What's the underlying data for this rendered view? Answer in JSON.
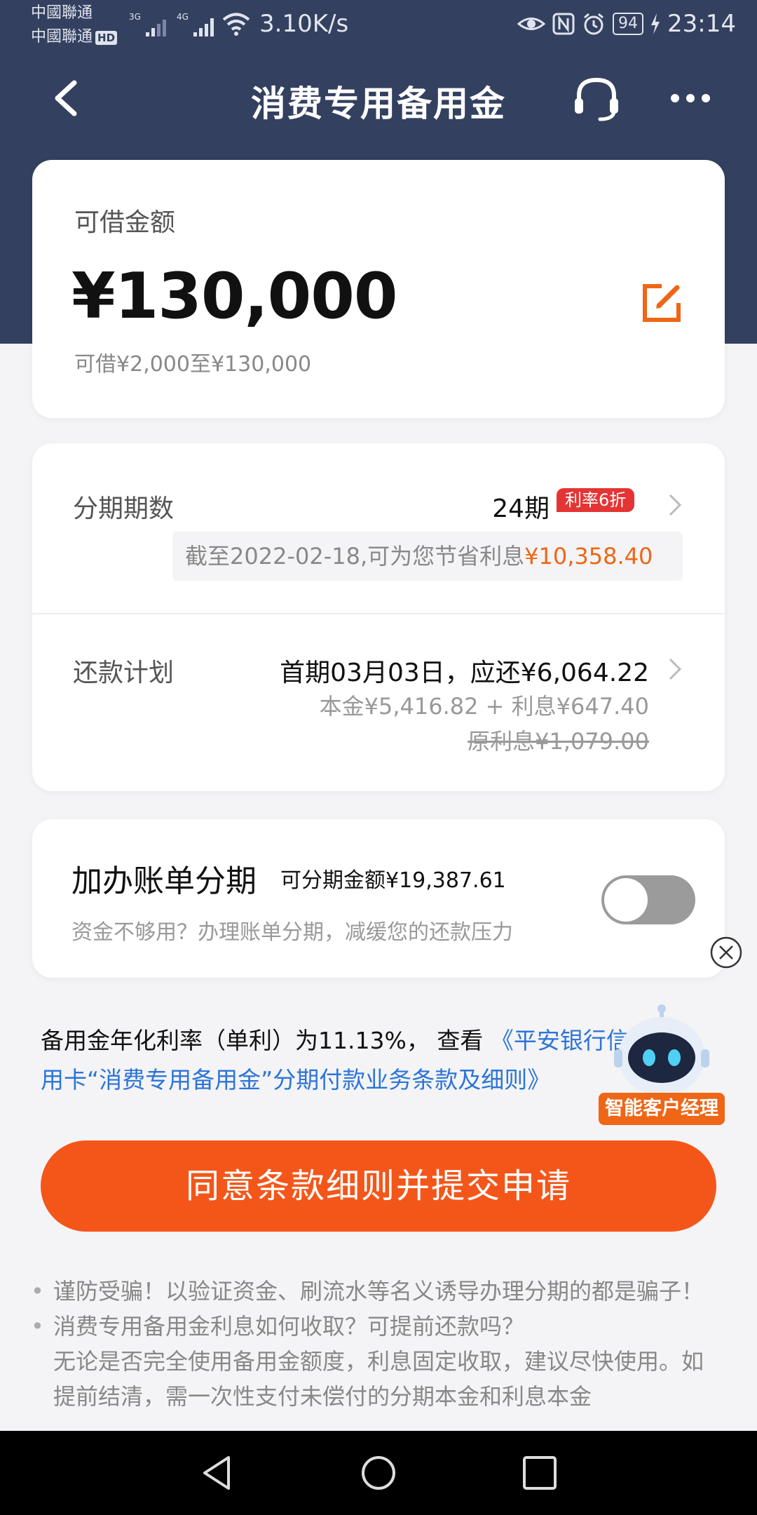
{
  "status_bar": {
    "carrier_1": "中國聯通",
    "carrier_2": "中國聯通",
    "hd": "HD",
    "net_3g": "3G",
    "net_4g": "4G",
    "speed": "3.10K/s",
    "battery": "94",
    "time": "23:14"
  },
  "nav": {
    "title": "消费专用备用金",
    "back_icon": "chevron-left-icon",
    "service_icon": "headset-icon",
    "more_icon": "more-dots-icon"
  },
  "amount_card": {
    "label": "可借金额",
    "value": "¥130,000",
    "range": "可借¥2,000至¥130,000",
    "edit_icon": "edit-icon"
  },
  "plan_card": {
    "period_label": "分期期数",
    "period_value": "24期",
    "rate_badge": "利率6折",
    "savings_text": "截至2022-02-18,可为您节省利息",
    "savings_amount": "¥10,358.40",
    "repay_label": "还款计划",
    "repay_first": "首期03月03日，应还¥6,064.22",
    "repay_breakdown": "本金¥5,416.82 + 利息¥647.40",
    "repay_original": "原利息¥1,079.00"
  },
  "bill_card": {
    "title": "加办账单分期",
    "available": "可分期金额¥19,387.61",
    "desc": "资金不够用？办理账单分期，减缓您的还款压力",
    "toggle_on": false
  },
  "terms": {
    "text": "备用金年化利率（单利）为11.13%， 查看 ",
    "link": "《平安银行信用卡“消费专用备用金”分期付款业务条款及细则》"
  },
  "assistant": {
    "label": "智能客户经理"
  },
  "submit_label": "同意条款细则并提交申请",
  "tips": [
    {
      "title": "谨防受骗！以验证资金、刷流水等名义诱导办理分期的都是骗子！"
    },
    {
      "title": "消费专用备用金利息如何收取？可提前还款吗？",
      "body": "无论是否完全使用备用金额度，利息固定收取，建议尽快使用。如提前结清，需一次性支付未偿付的分期本金和利息本金"
    }
  ],
  "colors": {
    "header": "#34405f",
    "accent": "#f4561a",
    "link": "#2d74d8",
    "badge": "#e53434"
  }
}
